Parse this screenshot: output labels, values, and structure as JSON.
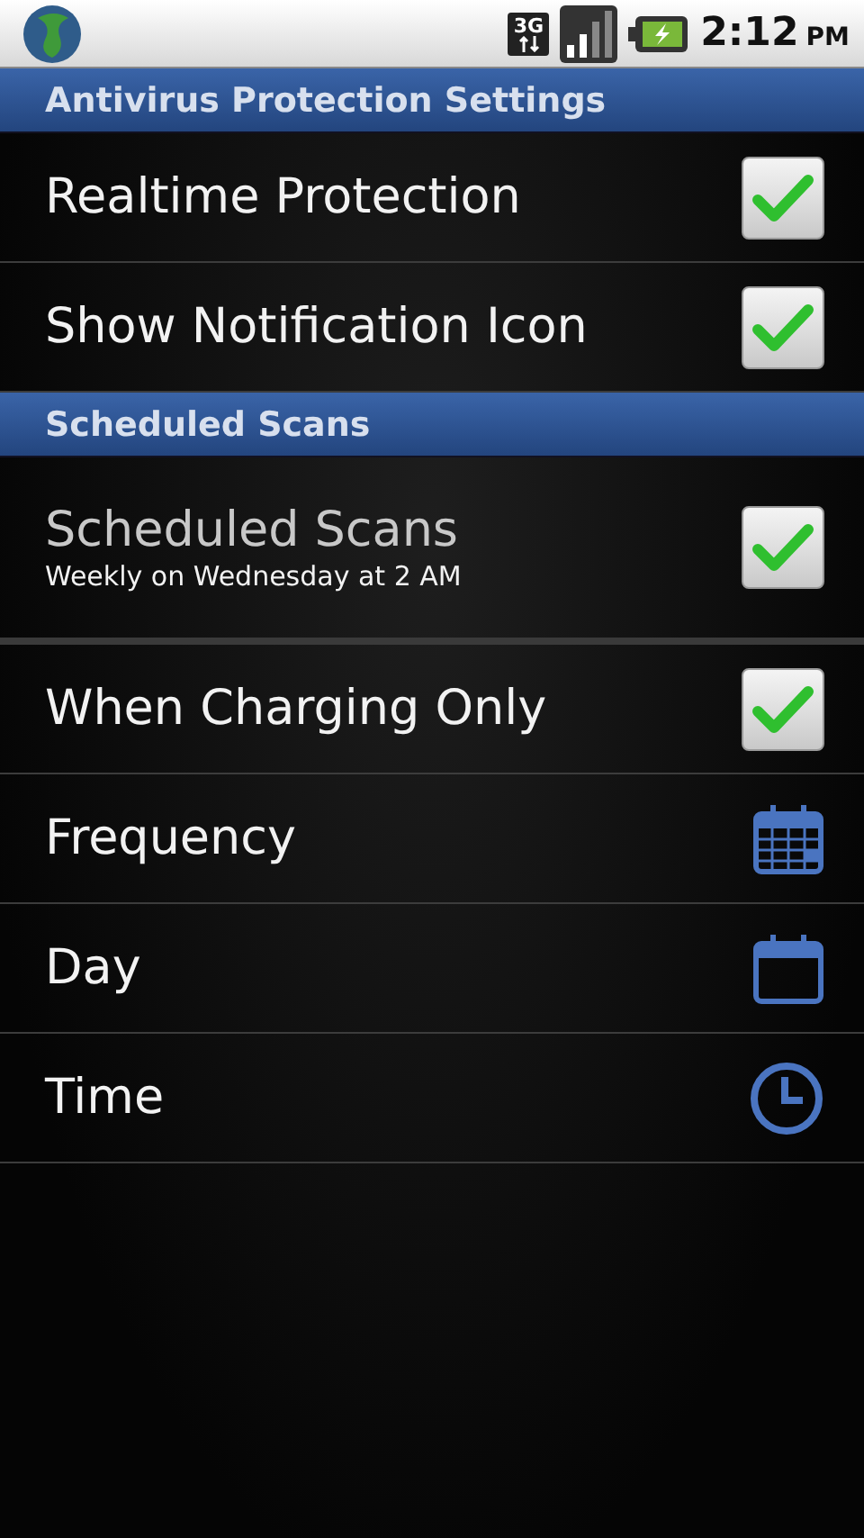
{
  "status_bar": {
    "network": "3G",
    "time": "2:12",
    "ampm": "PM"
  },
  "sections": [
    {
      "title": "Antivirus Protection Settings",
      "items": [
        {
          "kind": "checkbox",
          "label": "Realtime Protection",
          "checked": true
        },
        {
          "kind": "checkbox",
          "label": "Show Notification Icon",
          "checked": true
        }
      ]
    },
    {
      "title": "Scheduled Scans",
      "items": [
        {
          "kind": "checkbox",
          "label": "Scheduled Scans",
          "summary": "Weekly on Wednesday at 2 AM",
          "checked": true
        },
        {
          "kind": "checkbox",
          "label": "When Charging Only",
          "checked": true
        },
        {
          "kind": "calendar",
          "label": "Frequency"
        },
        {
          "kind": "date",
          "label": "Day"
        },
        {
          "kind": "clock",
          "label": "Time"
        }
      ]
    }
  ]
}
